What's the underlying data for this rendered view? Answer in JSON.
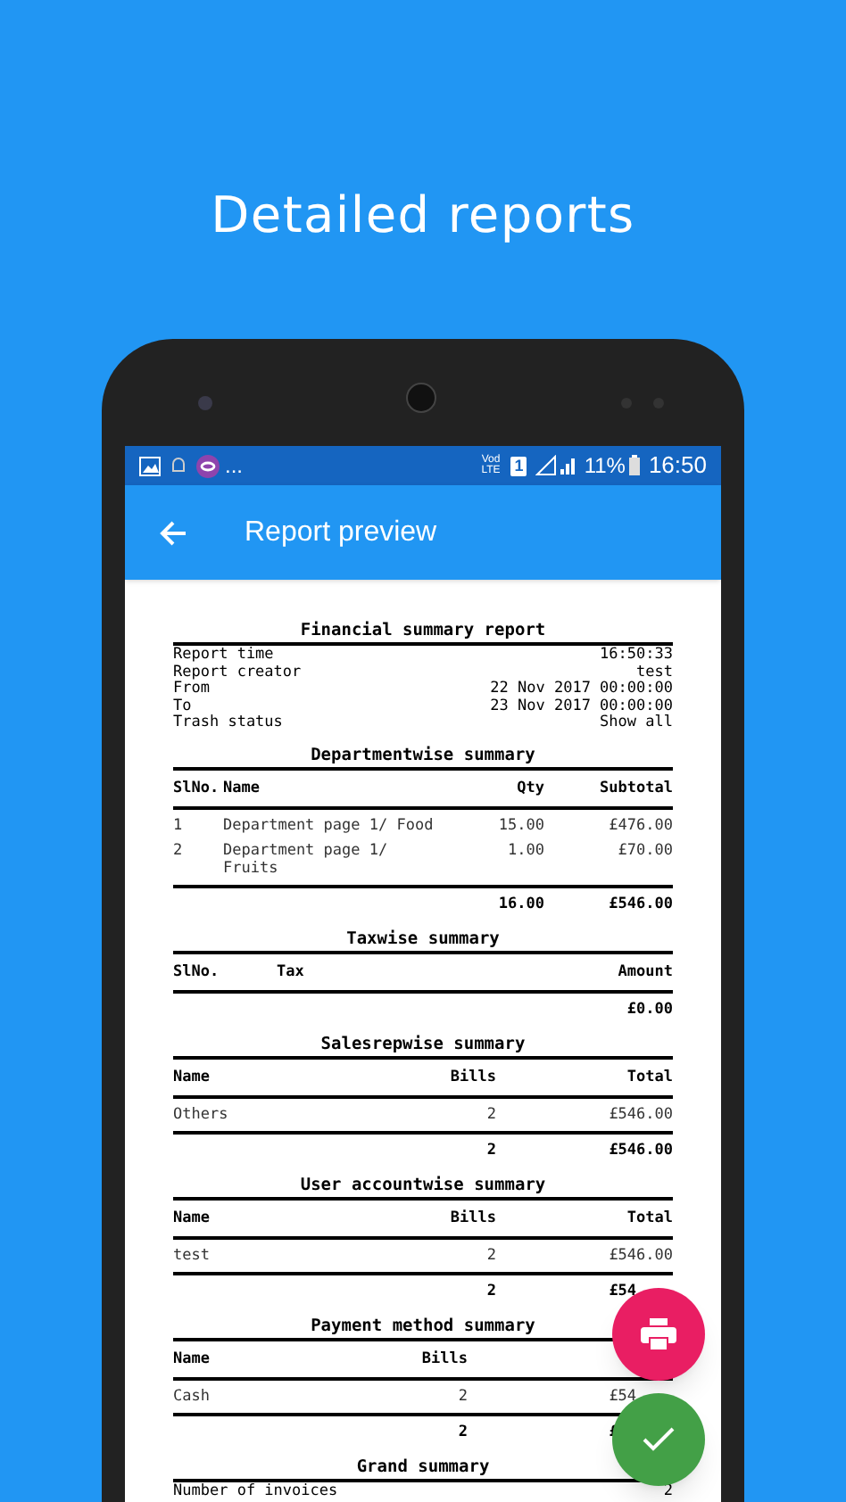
{
  "headline": "Detailed reports",
  "status_bar": {
    "more": "...",
    "network_top": "Vod",
    "network_bottom": "LTE",
    "sim": "1",
    "battery": "11%",
    "time": "16:50"
  },
  "app_bar": {
    "title": "Report preview"
  },
  "report": {
    "title": "Financial summary report",
    "info": [
      {
        "label": "Report time",
        "value": "16:50:33"
      },
      {
        "label": "Report creator",
        "value": "test"
      },
      {
        "label": "From",
        "value": "22 Nov 2017 00:00:00"
      },
      {
        "label": "To",
        "value": "23 Nov 2017 00:00:00"
      },
      {
        "label": "Trash status",
        "value": "Show all"
      }
    ],
    "sections": [
      {
        "kind": "department",
        "title": "Departmentwise summary",
        "columns": [
          "SlNo.",
          "Name",
          "Qty",
          "Subtotal"
        ],
        "rows": [
          [
            "1",
            "Department page 1/ Food",
            "15.00",
            "£476.00"
          ],
          [
            "2",
            "Department page 1/ Fruits",
            "1.00",
            "£70.00"
          ]
        ],
        "total": {
          "qty": "16.00",
          "amount": "£546.00"
        }
      },
      {
        "kind": "tax",
        "title": "Taxwise summary",
        "columns": [
          "SlNo.",
          "Tax",
          "Amount"
        ],
        "total": {
          "amount": "£0.00"
        }
      },
      {
        "kind": "people",
        "title": "Salesrepwise summary",
        "columns": [
          "Name",
          "Bills",
          "Total"
        ],
        "rows": [
          [
            "Others",
            "2",
            "£546.00"
          ]
        ],
        "total": {
          "bills": "2",
          "amount": "£546.00"
        }
      },
      {
        "kind": "people",
        "title": "User accountwise summary",
        "columns": [
          "Name",
          "Bills",
          "Total"
        ],
        "rows": [
          [
            "test",
            "2",
            "£546.00"
          ]
        ],
        "total": {
          "bills": "2",
          "amount": "£54"
        }
      },
      {
        "kind": "payment",
        "title": "Payment method summary",
        "columns": [
          "Name",
          "Bills"
        ],
        "rows": [
          [
            "Cash",
            "2",
            "£54"
          ]
        ],
        "total": {
          "bills": "2",
          "amount": "£"
        }
      }
    ],
    "grand": {
      "title": "Grand summary",
      "rows": [
        {
          "label": "Number of invoices",
          "value": "2"
        }
      ]
    }
  }
}
